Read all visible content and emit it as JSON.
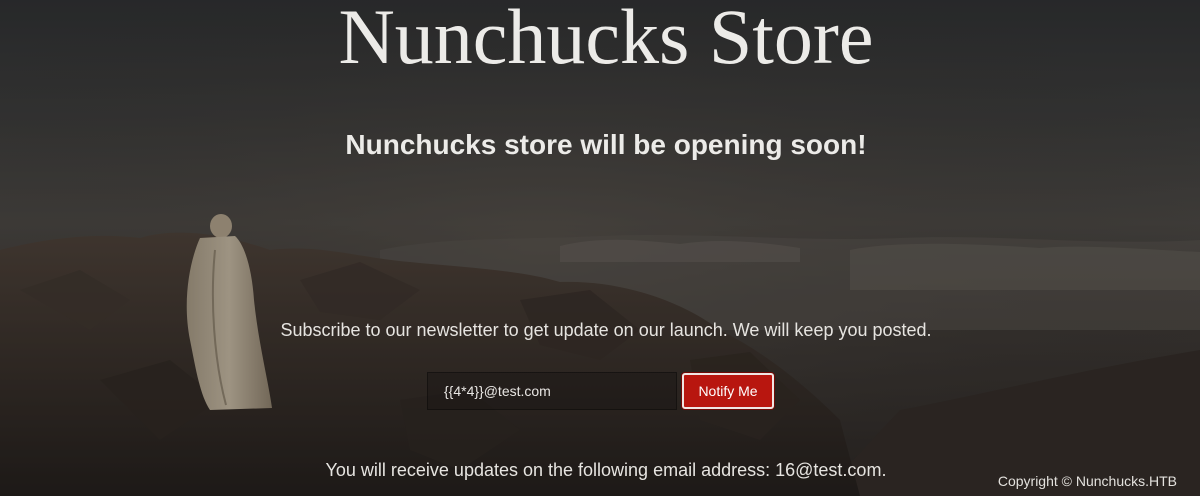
{
  "page": {
    "title": "Nunchucks Store",
    "subtitle": "Nunchucks store will be opening soon!",
    "newsletter_text": "Subscribe to our newsletter to get update on our launch. We will keep you posted.",
    "confirmation_text": "You will receive updates on the following email address: 16@test.com.",
    "copyright": "Copyright © Nunchucks.HTB"
  },
  "form": {
    "email_value": "{{4*4}}@test.com",
    "notify_label": "Notify Me"
  },
  "colors": {
    "accent": "#b8160f",
    "text": "#ecebe8",
    "background": "#2a2825"
  },
  "icons": {
    "background": "mountain-summit-photo"
  }
}
